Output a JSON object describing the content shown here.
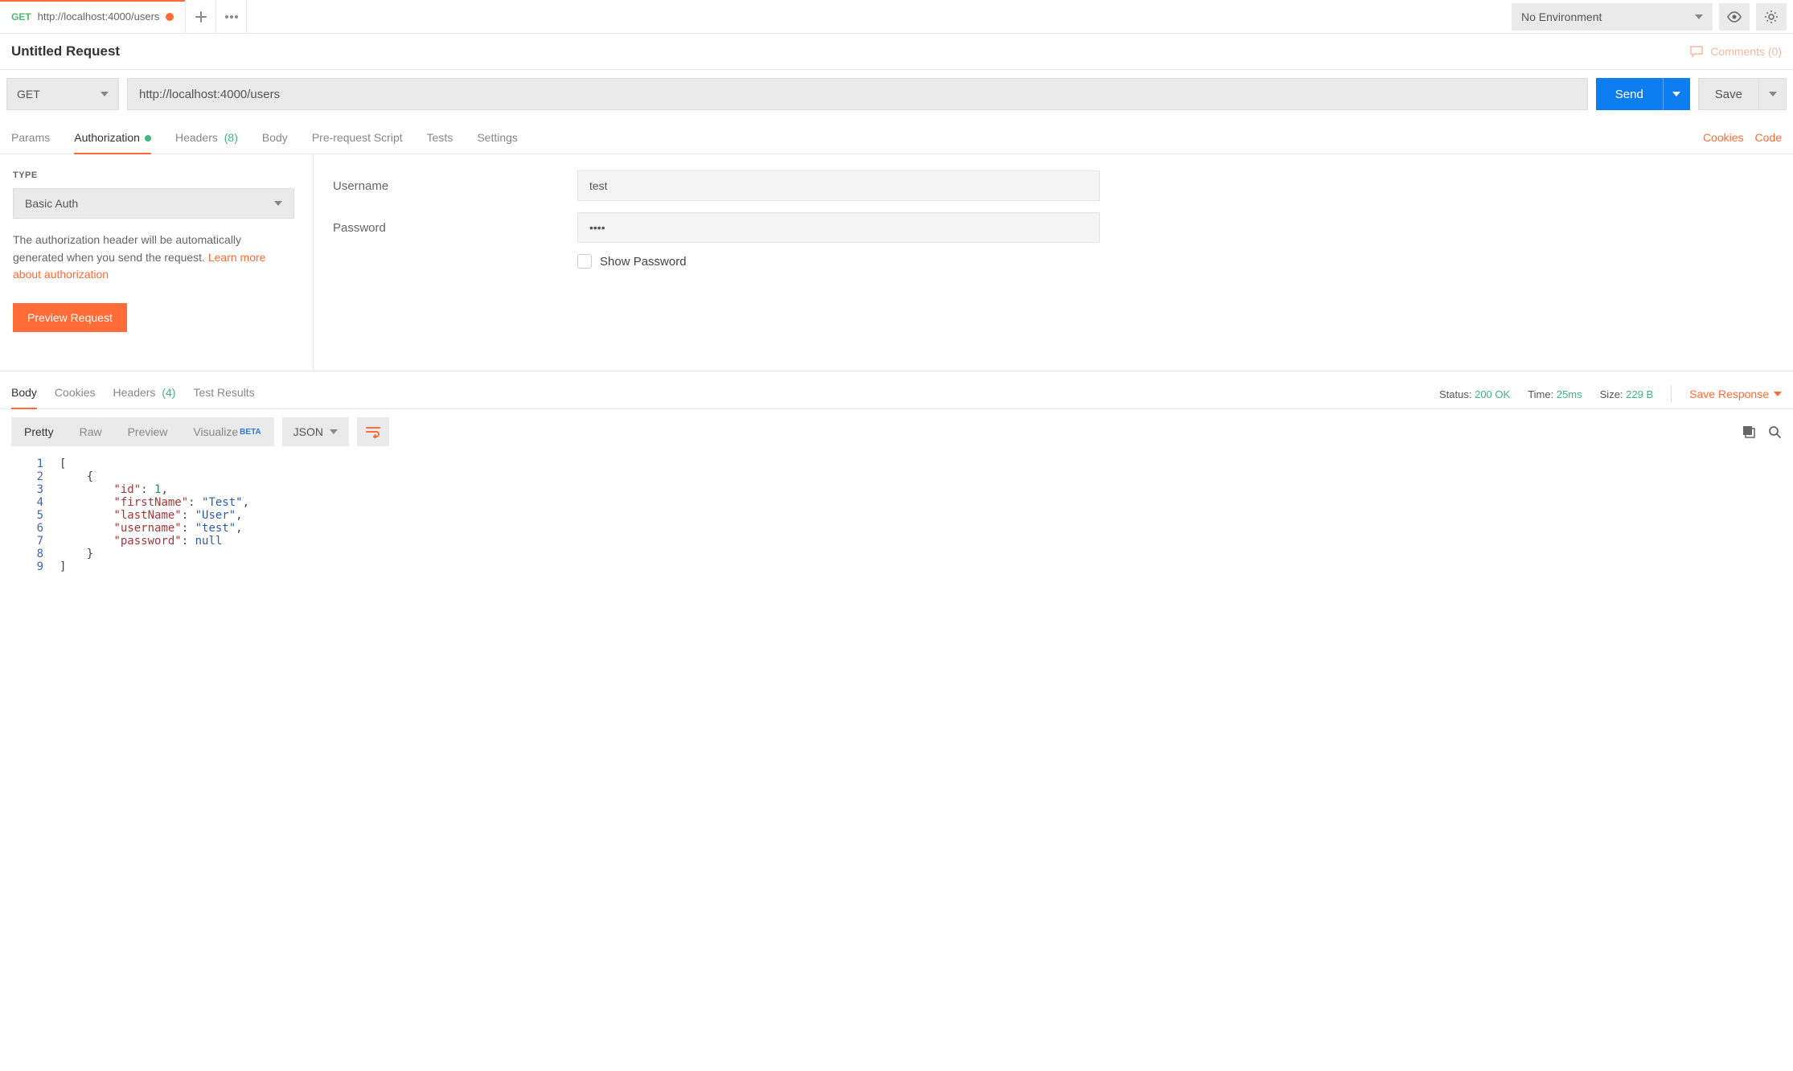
{
  "topbar": {
    "tab_method": "GET",
    "tab_url": "http://localhost:4000/users",
    "env_label": "No Environment"
  },
  "title": {
    "name": "Untitled Request",
    "comments_label": "Comments (0)"
  },
  "request": {
    "method": "GET",
    "url": "http://localhost:4000/users",
    "send_label": "Send",
    "save_label": "Save"
  },
  "req_tabs": {
    "params": "Params",
    "authorization": "Authorization",
    "headers": "Headers",
    "headers_count": "(8)",
    "body": "Body",
    "prerequest": "Pre-request Script",
    "tests": "Tests",
    "settings": "Settings",
    "cookies": "Cookies",
    "code": "Code"
  },
  "auth": {
    "type_label": "TYPE",
    "type_value": "Basic Auth",
    "desc_part1": "The authorization header will be automatically generated when you send the request. ",
    "desc_link": "Learn more about authorization",
    "preview_btn": "Preview Request",
    "username_label": "Username",
    "username_value": "test",
    "password_label": "Password",
    "password_value": "••••",
    "show_pw": "Show Password"
  },
  "resp_tabs": {
    "body": "Body",
    "cookies": "Cookies",
    "headers": "Headers",
    "headers_count": "(4)",
    "test_results": "Test Results"
  },
  "resp_meta": {
    "status_label": "Status:",
    "status_value": "200 OK",
    "time_label": "Time:",
    "time_value": "25ms",
    "size_label": "Size:",
    "size_value": "229 B",
    "save_resp": "Save Response"
  },
  "view": {
    "pretty": "Pretty",
    "raw": "Raw",
    "preview": "Preview",
    "visualize": "Visualize",
    "beta": "BETA",
    "dd": "JSON"
  },
  "code_lines": [
    {
      "n": "1",
      "indent": "",
      "tokens": [
        {
          "t": "[",
          "c": "punc"
        }
      ]
    },
    {
      "n": "2",
      "indent": "    ",
      "tokens": [
        {
          "t": "{",
          "c": "punc"
        }
      ]
    },
    {
      "n": "3",
      "indent": "        ",
      "tokens": [
        {
          "t": "\"id\"",
          "c": "key"
        },
        {
          "t": ": ",
          "c": "punc"
        },
        {
          "t": "1",
          "c": "num"
        },
        {
          "t": ",",
          "c": "punc"
        }
      ]
    },
    {
      "n": "4",
      "indent": "        ",
      "tokens": [
        {
          "t": "\"firstName\"",
          "c": "key"
        },
        {
          "t": ": ",
          "c": "punc"
        },
        {
          "t": "\"Test\"",
          "c": "str"
        },
        {
          "t": ",",
          "c": "punc"
        }
      ]
    },
    {
      "n": "5",
      "indent": "        ",
      "tokens": [
        {
          "t": "\"lastName\"",
          "c": "key"
        },
        {
          "t": ": ",
          "c": "punc"
        },
        {
          "t": "\"User\"",
          "c": "str"
        },
        {
          "t": ",",
          "c": "punc"
        }
      ]
    },
    {
      "n": "6",
      "indent": "        ",
      "tokens": [
        {
          "t": "\"username\"",
          "c": "key"
        },
        {
          "t": ": ",
          "c": "punc"
        },
        {
          "t": "\"test\"",
          "c": "str"
        },
        {
          "t": ",",
          "c": "punc"
        }
      ]
    },
    {
      "n": "7",
      "indent": "        ",
      "tokens": [
        {
          "t": "\"password\"",
          "c": "key"
        },
        {
          "t": ": ",
          "c": "punc"
        },
        {
          "t": "null",
          "c": "null"
        }
      ]
    },
    {
      "n": "8",
      "indent": "    ",
      "tokens": [
        {
          "t": "}",
          "c": "punc"
        }
      ]
    },
    {
      "n": "9",
      "indent": "",
      "tokens": [
        {
          "t": "]",
          "c": "punc"
        }
      ]
    }
  ]
}
